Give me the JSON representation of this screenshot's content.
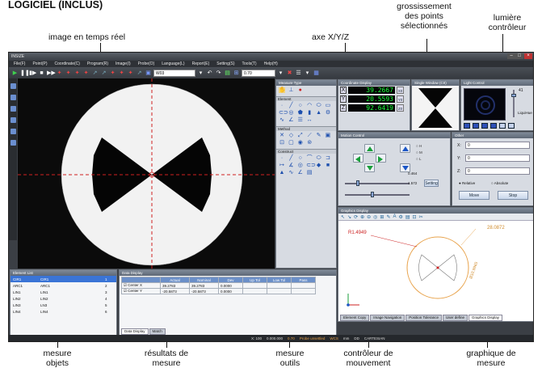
{
  "heading": "LOGICIEL (INCLUS)",
  "callouts": {
    "image_live": "image en temps réel",
    "axes": "axe X/Y/Z",
    "zoom": [
      "grossissement",
      "des points",
      "sélectionnés"
    ],
    "light": [
      "lumière",
      "contrôleur"
    ],
    "measure_objects": [
      "mesure",
      "objets"
    ],
    "results": [
      "résultats de",
      "mesure"
    ],
    "tools": [
      "mesure",
      "outils"
    ],
    "motion": [
      "contrôleur de",
      "mouvement"
    ],
    "graphic": [
      "graphique de",
      "mesure"
    ]
  },
  "app": {
    "title": "INSIZE",
    "menus": [
      "File(F)",
      "Point(P)",
      "Coordinate(C)",
      "Program(R)",
      "Image(I)",
      "Probe(O)",
      "Language(L)",
      "Report(E)",
      "Setting(S)",
      "Tools(T)",
      "Help(H)"
    ],
    "toolbar": {
      "program_field": "W03",
      "zoom_field": "0.70"
    },
    "panels": {
      "measure_type": "Measure Type",
      "element": "Element",
      "method": "Method",
      "construct": "Construct",
      "coordinate_display": "Coordinate Display",
      "image_window": "Single Window (CII)",
      "light_control": "Light Control",
      "motion_control": "Motion Control",
      "other": "Other",
      "graphics_display": "Graphics Display",
      "element_list": "Element List",
      "data_display": "Data Display"
    },
    "dro": [
      {
        "axis": "X",
        "value": "39.2667",
        "unit": "X0"
      },
      {
        "axis": "Y",
        "value": "20.5593",
        "unit": "Y0"
      },
      {
        "axis": "Z",
        "value": "92.6419",
        "unit": "Z0"
      }
    ],
    "light": {
      "value": "41",
      "label": "LiquiHue"
    },
    "motion": {
      "speed1": "0.464",
      "speed2": "1.572",
      "setting": "Setting"
    },
    "other": {
      "x_label": "X:",
      "x_val": "0",
      "y_label": "Y:",
      "y_val": "0",
      "z_label": "Z:",
      "z_val": "0",
      "relative": "Relative",
      "absolute": "Absolute",
      "move": "Move",
      "stop": "Stop"
    },
    "graphics": {
      "label_left": "R1.4949",
      "label_right": "28.0872",
      "label_diam": "Ø10.9965",
      "tabs": [
        "Element Copy",
        "Image Navigation",
        "Position Tolerance",
        "User define",
        "Graphics Display"
      ]
    },
    "element_list": {
      "items": [
        {
          "name": "CIR1",
          "ref": "CIR1",
          "n": "1"
        },
        {
          "name": "ARC1",
          "ref": "ARC1",
          "n": "2"
        },
        {
          "name": "LIN1",
          "ref": "LIN1",
          "n": "3"
        },
        {
          "name": "LIN2",
          "ref": "LIN2",
          "n": "4"
        },
        {
          "name": "LIN3",
          "ref": "LN3",
          "n": "5"
        },
        {
          "name": "LIN4",
          "ref": "LIN4",
          "n": "6"
        }
      ]
    },
    "data_display": {
      "headers": [
        "",
        "Actual",
        "Nominal",
        "Dev",
        "Up Tol",
        "Low Tol",
        "Pass"
      ],
      "rows": [
        {
          "name": "Center X",
          "actual": "39.2783",
          "nominal": "39.2783",
          "dev": "0.0000"
        },
        {
          "name": "Center Y",
          "actual": "-20.5873",
          "nominal": "-20.5873",
          "dev": "0.0000"
        }
      ],
      "tabs": [
        "Data Display",
        "Match"
      ]
    },
    "status": [
      "X: 100",
      "0.000.000",
      "0.70",
      "Probe unsettled",
      "WCS",
      "",
      "mm",
      "DD",
      "CARTESIAN"
    ]
  },
  "colors": {
    "dro_text": "#19ff3a",
    "accent_red": "#cc2222",
    "graphic_orange": "#e8a24a"
  }
}
